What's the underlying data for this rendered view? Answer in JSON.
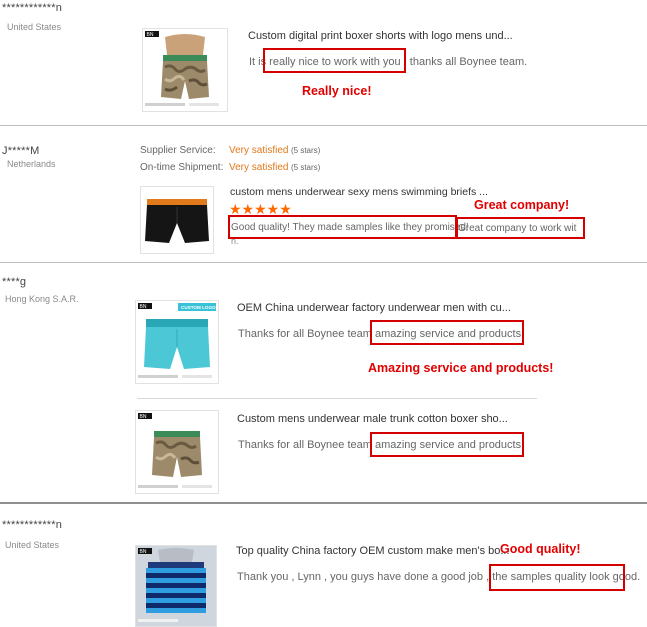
{
  "reviews": [
    {
      "buyer": "************n",
      "country": "United States",
      "items": [
        {
          "title": "Custom digital print boxer shorts with logo mens und...",
          "text_pre": "It is ",
          "text_hl": "really nice to work with you ,",
          "text_post": " thanks all Boynee team.",
          "callout": "Really nice!"
        }
      ]
    },
    {
      "buyer": "J*****M",
      "country": "Netherlands",
      "supplier_service_label": "Supplier Service:",
      "supplier_service_value": "Very satisfied",
      "supplier_service_stars": "(5 stars)",
      "shipment_label": "On-time Shipment:",
      "shipment_value": "Very satisfied",
      "shipment_stars": "(5 stars)",
      "items": [
        {
          "title": "custom mens underwear sexy mens swimming briefs ...",
          "stars": "★★★★★",
          "text_hl": "Good quality! They made samples like they promised!",
          "text_hl2": "Great company to work wit",
          "text_wrap": "h.",
          "callout": "Great company!"
        }
      ]
    },
    {
      "buyer": "****g",
      "country": "Hong Kong S.A.R.",
      "items": [
        {
          "title": "OEM China underwear factory underwear men with cu...",
          "text_pre": "Thanks for all Boynee team ",
          "text_hl": "amazing service and products.",
          "callout": "Amazing service and products!"
        },
        {
          "title": "Custom mens underwear male trunk cotton boxer sho...",
          "text_pre": "Thanks for all Boynee team ",
          "text_hl": "amazing service and products."
        }
      ]
    },
    {
      "buyer": "************n",
      "country": "United States",
      "items": [
        {
          "title": "Top quality China factory OEM custom make men's bo...",
          "text_pre": "Thank you , Lynn , you guys have done a good job , the ",
          "text_hl": "samples quality look good.",
          "callout": "Good quality!"
        }
      ]
    }
  ],
  "thumbs": {
    "brand_mark": "BN",
    "custom_logo_label": "CUSTOM LOGO"
  },
  "colors": {
    "highlight": "#d40000",
    "callout": "#e10000",
    "rating_value": "#e0791c",
    "stars": "#ff6a00"
  }
}
